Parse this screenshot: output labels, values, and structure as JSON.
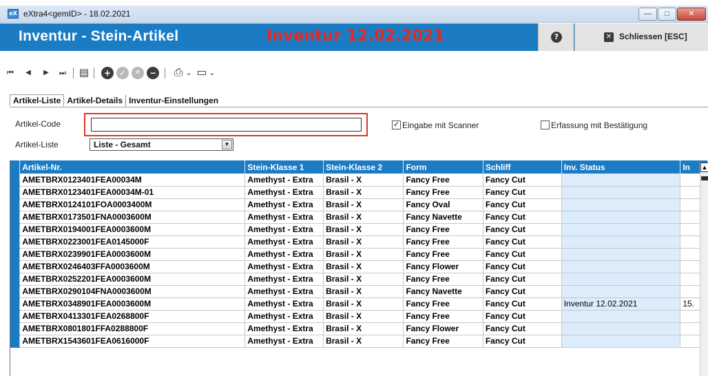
{
  "window": {
    "title": "eXtra4<gemID>  -  18.02.2021",
    "app_icon_label": "eX",
    "minimize": "—",
    "maximize": "□",
    "close": "✕"
  },
  "header": {
    "title": "Inventur - Stein-Artikel",
    "subtitle": "Inventur 12.02.2021",
    "help_glyph": "?",
    "close_icon_glyph": "✕",
    "close_label": "Schliessen [ESC]",
    "bg_color": "#1b7cc4",
    "subtitle_color": "#e8271f"
  },
  "toolbar": {
    "first": "⏮",
    "prev": "◀",
    "next": "▶",
    "last": "⏭",
    "list": "▤",
    "add": "+",
    "confirm": "✓",
    "cancel": "✕",
    "remove": "−",
    "print": "⎙",
    "print_menu": "⌄",
    "window": "▭",
    "window_menu": "⌄"
  },
  "tabs": [
    {
      "label": "Artikel-Liste",
      "active": true
    },
    {
      "label": "Artikel-Details",
      "active": false
    },
    {
      "label": "Inventur-Einstellungen",
      "active": false
    }
  ],
  "form": {
    "artikel_code_label": "Artikel-Code",
    "artikel_code_value": "",
    "scanner_checkbox_label": "Eingabe mit Scanner",
    "scanner_checked": true,
    "confirm_checkbox_label": "Erfassung mit Bestätigung",
    "confirm_checked": false,
    "artikel_liste_label": "Artikel-Liste",
    "artikel_liste_value": "Liste - Gesamt",
    "check_glyph": "✓",
    "dropdown_arrow": "▼"
  },
  "grid": {
    "columns": [
      "Artikel-Nr.",
      "Stein-Klasse 1",
      "Stein-Klasse 2",
      "Form",
      "Schliff",
      "Inv. Status",
      "In"
    ],
    "rows": [
      [
        "AMETBRX0123401FEA00034M",
        "Amethyst - Extra",
        "Brasil - X",
        "Fancy Free",
        "Fancy Cut",
        "",
        ""
      ],
      [
        "AMETBRX0123401FEA00034M-01",
        "Amethyst - Extra",
        "Brasil - X",
        "Fancy Free",
        "Fancy Cut",
        "",
        ""
      ],
      [
        "AMETBRX0124101FOA0003400M",
        "Amethyst - Extra",
        "Brasil - X",
        "Fancy Oval",
        "Fancy Cut",
        "",
        ""
      ],
      [
        "AMETBRX0173501FNA0003600M",
        "Amethyst - Extra",
        "Brasil - X",
        "Fancy Navette",
        "Fancy Cut",
        "",
        ""
      ],
      [
        "AMETBRX0194001FEA0003600M",
        "Amethyst - Extra",
        "Brasil - X",
        "Fancy Free",
        "Fancy Cut",
        "",
        ""
      ],
      [
        "AMETBRX0223001FEA0145000F",
        "Amethyst - Extra",
        "Brasil - X",
        "Fancy Free",
        "Fancy Cut",
        "",
        ""
      ],
      [
        "AMETBRX0239901FEA0003600M",
        "Amethyst - Extra",
        "Brasil - X",
        "Fancy Free",
        "Fancy Cut",
        "",
        ""
      ],
      [
        "AMETBRX0246403FFA0003600M",
        "Amethyst - Extra",
        "Brasil - X",
        "Fancy Flower",
        "Fancy Cut",
        "",
        ""
      ],
      [
        "AMETBRX0252201FEA0003600M",
        "Amethyst - Extra",
        "Brasil - X",
        "Fancy Free",
        "Fancy Cut",
        "",
        ""
      ],
      [
        "AMETBRX0290104FNA0003600M",
        "Amethyst - Extra",
        "Brasil - X",
        "Fancy Navette",
        "Fancy Cut",
        "",
        ""
      ],
      [
        "AMETBRX0348901FEA0003600M",
        "Amethyst - Extra",
        "Brasil - X",
        "Fancy Free",
        "Fancy Cut",
        "Inventur 12.02.2021",
        "15."
      ],
      [
        "AMETBRX0413301FEA0268800F",
        "Amethyst - Extra",
        "Brasil - X",
        "Fancy Free",
        "Fancy Cut",
        "",
        ""
      ],
      [
        "AMETBRX0801801FFA0288800F",
        "Amethyst - Extra",
        "Brasil - X",
        "Fancy Flower",
        "Fancy Cut",
        "",
        ""
      ],
      [
        "AMETBRX1543601FEA0616000F",
        "Amethyst - Extra",
        "Brasil - X",
        "Fancy Free",
        "Fancy Cut",
        "",
        ""
      ]
    ]
  },
  "scrollbar": {
    "up_arrow": "▲"
  }
}
